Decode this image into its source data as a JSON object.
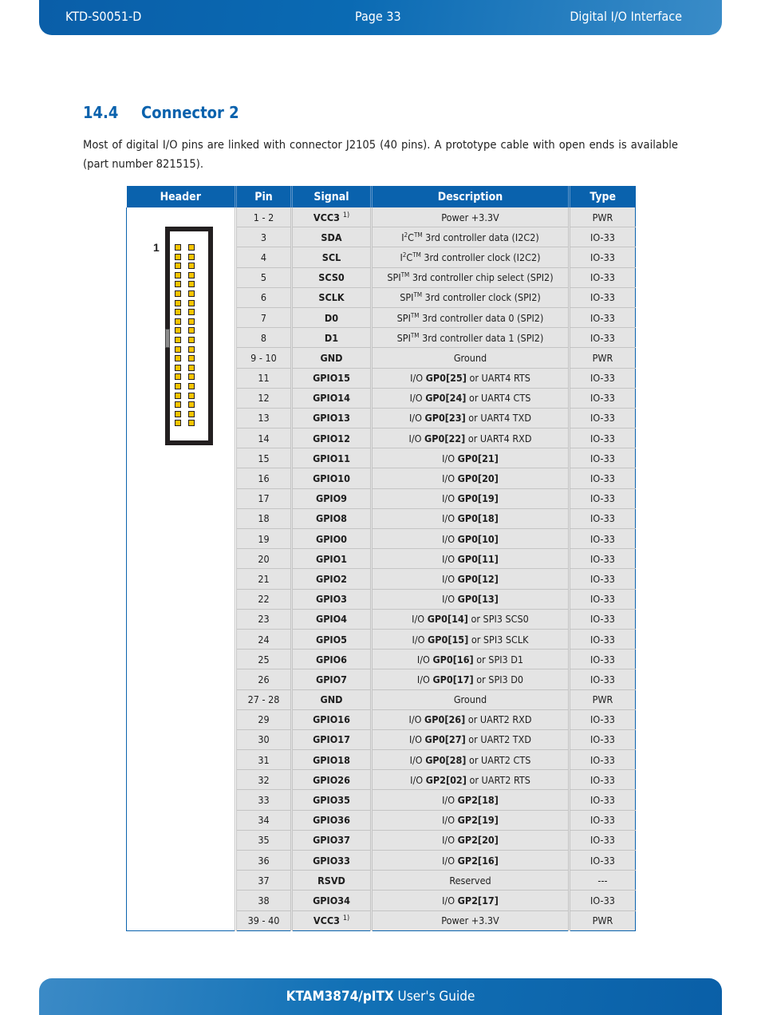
{
  "header": {
    "doc_id": "KTD-S0051-D",
    "page": "Page 33",
    "section": "Digital I/O Interface"
  },
  "footer": {
    "product": "KTAM3874/pITX",
    "guide": " User's Guide"
  },
  "section": {
    "number": "14.4",
    "title": "Connector 2",
    "intro": "Most of digital I/O pins are linked with connector J2105 (40 pins). A prototype cable with open ends is available (part number 821515)."
  },
  "figure": {
    "pin1_label": "1",
    "pin_rows": 20,
    "pin_cols": 2,
    "pin_color": "#f7c400"
  },
  "table": {
    "columns": [
      "Header",
      "Pin",
      "Signal",
      "Description",
      "Type"
    ],
    "rows": [
      {
        "pin": "1 - 2",
        "signal": "VCC3",
        "note": "1)",
        "desc": [
          {
            "t": "Power +3.3V"
          }
        ],
        "type": "PWR"
      },
      {
        "pin": "3",
        "signal": "SDA",
        "desc": [
          {
            "t": "I"
          },
          {
            "sup": "2"
          },
          {
            "t": "C"
          },
          {
            "sup": "TM"
          },
          {
            "t": " 3rd controller data (I2C2)"
          }
        ],
        "type": "IO-33"
      },
      {
        "pin": "4",
        "signal": "SCL",
        "desc": [
          {
            "t": "I"
          },
          {
            "sup": "2"
          },
          {
            "t": "C"
          },
          {
            "sup": "TM"
          },
          {
            "t": " 3rd controller clock (I2C2)"
          }
        ],
        "type": "IO-33"
      },
      {
        "pin": "5",
        "signal": "SCS0",
        "desc": [
          {
            "t": "SPI"
          },
          {
            "sup": "TM"
          },
          {
            "t": " 3rd controller chip select (SPI2)"
          }
        ],
        "type": "IO-33"
      },
      {
        "pin": "6",
        "signal": "SCLK",
        "desc": [
          {
            "t": "SPI"
          },
          {
            "sup": "TM"
          },
          {
            "t": " 3rd controller clock (SPI2)"
          }
        ],
        "type": "IO-33"
      },
      {
        "pin": "7",
        "signal": "D0",
        "desc": [
          {
            "t": "SPI"
          },
          {
            "sup": "TM"
          },
          {
            "t": " 3rd controller data 0 (SPI2)"
          }
        ],
        "type": "IO-33"
      },
      {
        "pin": "8",
        "signal": "D1",
        "desc": [
          {
            "t": "SPI"
          },
          {
            "sup": "TM"
          },
          {
            "t": " 3rd controller data 1 (SPI2)"
          }
        ],
        "type": "IO-33"
      },
      {
        "pin": "9 - 10",
        "signal": "GND",
        "desc": [
          {
            "t": "Ground"
          }
        ],
        "type": "PWR"
      },
      {
        "pin": "11",
        "signal": "GPIO15",
        "desc": [
          {
            "t": "I/O "
          },
          {
            "b": "GP0[25]"
          },
          {
            "t": " or UART4 RTS"
          }
        ],
        "type": "IO-33"
      },
      {
        "pin": "12",
        "signal": "GPIO14",
        "desc": [
          {
            "t": "I/O "
          },
          {
            "b": "GP0[24]"
          },
          {
            "t": " or UART4 CTS"
          }
        ],
        "type": "IO-33"
      },
      {
        "pin": "13",
        "signal": "GPIO13",
        "desc": [
          {
            "t": "I/O "
          },
          {
            "b": "GP0[23]"
          },
          {
            "t": " or UART4 TXD"
          }
        ],
        "type": "IO-33"
      },
      {
        "pin": "14",
        "signal": "GPIO12",
        "desc": [
          {
            "t": "I/O "
          },
          {
            "b": "GP0[22]"
          },
          {
            "t": " or UART4 RXD"
          }
        ],
        "type": "IO-33"
      },
      {
        "pin": "15",
        "signal": "GPIO11",
        "desc": [
          {
            "t": "I/O "
          },
          {
            "b": "GP0[21]"
          }
        ],
        "type": "IO-33"
      },
      {
        "pin": "16",
        "signal": "GPIO10",
        "desc": [
          {
            "t": "I/O "
          },
          {
            "b": "GP0[20]"
          }
        ],
        "type": "IO-33"
      },
      {
        "pin": "17",
        "signal": "GPIO9",
        "desc": [
          {
            "t": "I/O "
          },
          {
            "b": "GP0[19]"
          }
        ],
        "type": "IO-33"
      },
      {
        "pin": "18",
        "signal": "GPIO8",
        "desc": [
          {
            "t": "I/O "
          },
          {
            "b": "GP0[18]"
          }
        ],
        "type": "IO-33"
      },
      {
        "pin": "19",
        "signal": "GPIO0",
        "desc": [
          {
            "t": "I/O "
          },
          {
            "b": "GP0[10]"
          }
        ],
        "type": "IO-33"
      },
      {
        "pin": "20",
        "signal": "GPIO1",
        "desc": [
          {
            "t": "I/O "
          },
          {
            "b": "GP0[11]"
          }
        ],
        "type": "IO-33"
      },
      {
        "pin": "21",
        "signal": "GPIO2",
        "desc": [
          {
            "t": "I/O "
          },
          {
            "b": "GP0[12]"
          }
        ],
        "type": "IO-33"
      },
      {
        "pin": "22",
        "signal": "GPIO3",
        "desc": [
          {
            "t": "I/O "
          },
          {
            "b": "GP0[13]"
          }
        ],
        "type": "IO-33"
      },
      {
        "pin": "23",
        "signal": "GPIO4",
        "desc": [
          {
            "t": "I/O "
          },
          {
            "b": "GP0[14]"
          },
          {
            "t": " or SPI3 SCS0"
          }
        ],
        "type": "IO-33"
      },
      {
        "pin": "24",
        "signal": "GPIO5",
        "desc": [
          {
            "t": "I/O "
          },
          {
            "b": "GP0[15]"
          },
          {
            "t": " or SPI3 SCLK"
          }
        ],
        "type": "IO-33"
      },
      {
        "pin": "25",
        "signal": "GPIO6",
        "desc": [
          {
            "t": "I/O "
          },
          {
            "b": "GP0[16]"
          },
          {
            "t": " or SPI3 D1"
          }
        ],
        "type": "IO-33"
      },
      {
        "pin": "26",
        "signal": "GPIO7",
        "desc": [
          {
            "t": "I/O "
          },
          {
            "b": "GP0[17]"
          },
          {
            "t": " or SPI3 D0"
          }
        ],
        "type": "IO-33"
      },
      {
        "pin": "27 - 28",
        "signal": "GND",
        "desc": [
          {
            "t": "Ground"
          }
        ],
        "type": "PWR"
      },
      {
        "pin": "29",
        "signal": "GPIO16",
        "desc": [
          {
            "t": "I/O "
          },
          {
            "b": "GP0[26]"
          },
          {
            "t": " or UART2 RXD"
          }
        ],
        "type": "IO-33"
      },
      {
        "pin": "30",
        "signal": "GPIO17",
        "desc": [
          {
            "t": "I/O "
          },
          {
            "b": "GP0[27]"
          },
          {
            "t": " or UART2 TXD"
          }
        ],
        "type": "IO-33"
      },
      {
        "pin": "31",
        "signal": "GPIO18",
        "desc": [
          {
            "t": "I/O "
          },
          {
            "b": "GP0[28]"
          },
          {
            "t": " or UART2 CTS"
          }
        ],
        "type": "IO-33"
      },
      {
        "pin": "32",
        "signal": "GPIO26",
        "desc": [
          {
            "t": "I/O "
          },
          {
            "b": "GP2[02]"
          },
          {
            "t": " or UART2 RTS"
          }
        ],
        "type": "IO-33"
      },
      {
        "pin": "33",
        "signal": "GPIO35",
        "desc": [
          {
            "t": "I/O "
          },
          {
            "b": "GP2[18]"
          }
        ],
        "type": "IO-33"
      },
      {
        "pin": "34",
        "signal": "GPIO36",
        "desc": [
          {
            "t": "I/O "
          },
          {
            "b": "GP2[19]"
          }
        ],
        "type": "IO-33"
      },
      {
        "pin": "35",
        "signal": "GPIO37",
        "desc": [
          {
            "t": "I/O "
          },
          {
            "b": "GP2[20]"
          }
        ],
        "type": "IO-33"
      },
      {
        "pin": "36",
        "signal": "GPIO33",
        "desc": [
          {
            "t": "I/O "
          },
          {
            "b": "GP2[16]"
          }
        ],
        "type": "IO-33"
      },
      {
        "pin": "37",
        "signal": "RSVD",
        "desc": [
          {
            "t": "Reserved"
          }
        ],
        "type": "---"
      },
      {
        "pin": "38",
        "signal": "GPIO34",
        "desc": [
          {
            "t": "I/O "
          },
          {
            "b": "GP2[17]"
          }
        ],
        "type": "IO-33"
      },
      {
        "pin": "39 - 40",
        "signal": "VCC3",
        "note": "1)",
        "desc": [
          {
            "t": "Power +3.3V"
          }
        ],
        "type": "PWR"
      }
    ]
  }
}
